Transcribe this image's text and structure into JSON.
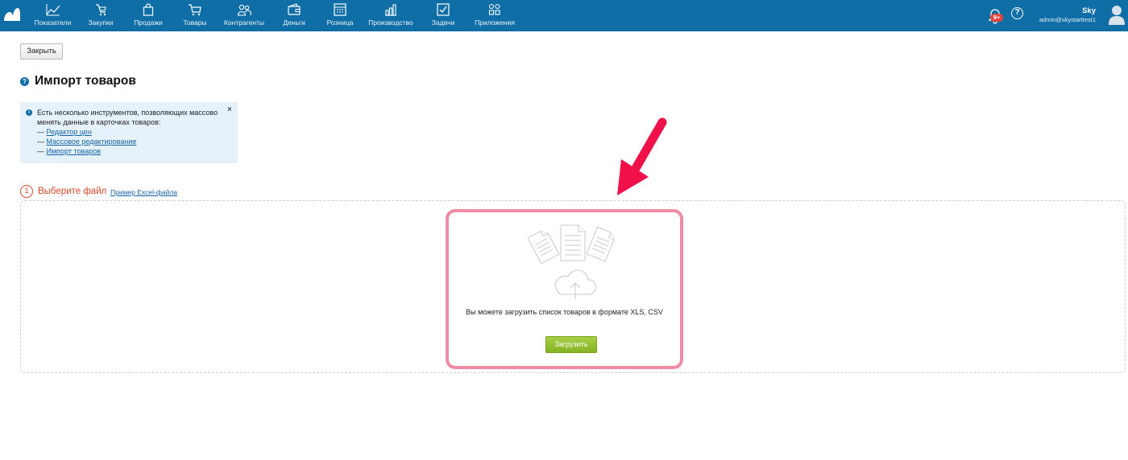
{
  "nav": {
    "items": [
      {
        "label": "Показатели",
        "icon": "chart-line-icon"
      },
      {
        "label": "Закупки",
        "icon": "purchases-icon"
      },
      {
        "label": "Продажи",
        "icon": "bag-icon"
      },
      {
        "label": "Товары",
        "icon": "cart-icon"
      },
      {
        "label": "Контрагенты",
        "icon": "people-icon"
      },
      {
        "label": "Деньги",
        "icon": "wallet-icon"
      },
      {
        "label": "Розница",
        "icon": "store-icon"
      },
      {
        "label": "Производство",
        "icon": "production-icon"
      },
      {
        "label": "Задачи",
        "icon": "checkbox-icon"
      },
      {
        "label": "Приложения",
        "icon": "apps-icon"
      }
    ],
    "notifications_badge": "9+",
    "help_glyph": "?",
    "user_name": "Sky",
    "user_email": "admin@skystarttest1"
  },
  "page": {
    "close_label": "Закрыть",
    "help_glyph": "?",
    "title": "Импорт товаров"
  },
  "info": {
    "text": "Есть несколько инструментов, позволяющих массово менять данные в карточках товаров:",
    "dash": "—",
    "close_glyph": "×",
    "info_glyph": "i",
    "links": [
      "Редактор цен",
      "Массовое редактирование",
      "Импорт товаров"
    ]
  },
  "step": {
    "number": "1",
    "label": "Выберите файл",
    "example_link": "Пример Excel-файла"
  },
  "upload": {
    "text": "Вы можете загрузить список товаров в формате XLS, CSV",
    "button": "Загрузить"
  },
  "colors": {
    "topbar": "#0f6ea5",
    "accent_red": "#d94729",
    "highlight_pink": "#f08ba6",
    "arrow": "#f0104a",
    "button_green": "#8ab92a",
    "info_bg": "#e6f2fb"
  }
}
